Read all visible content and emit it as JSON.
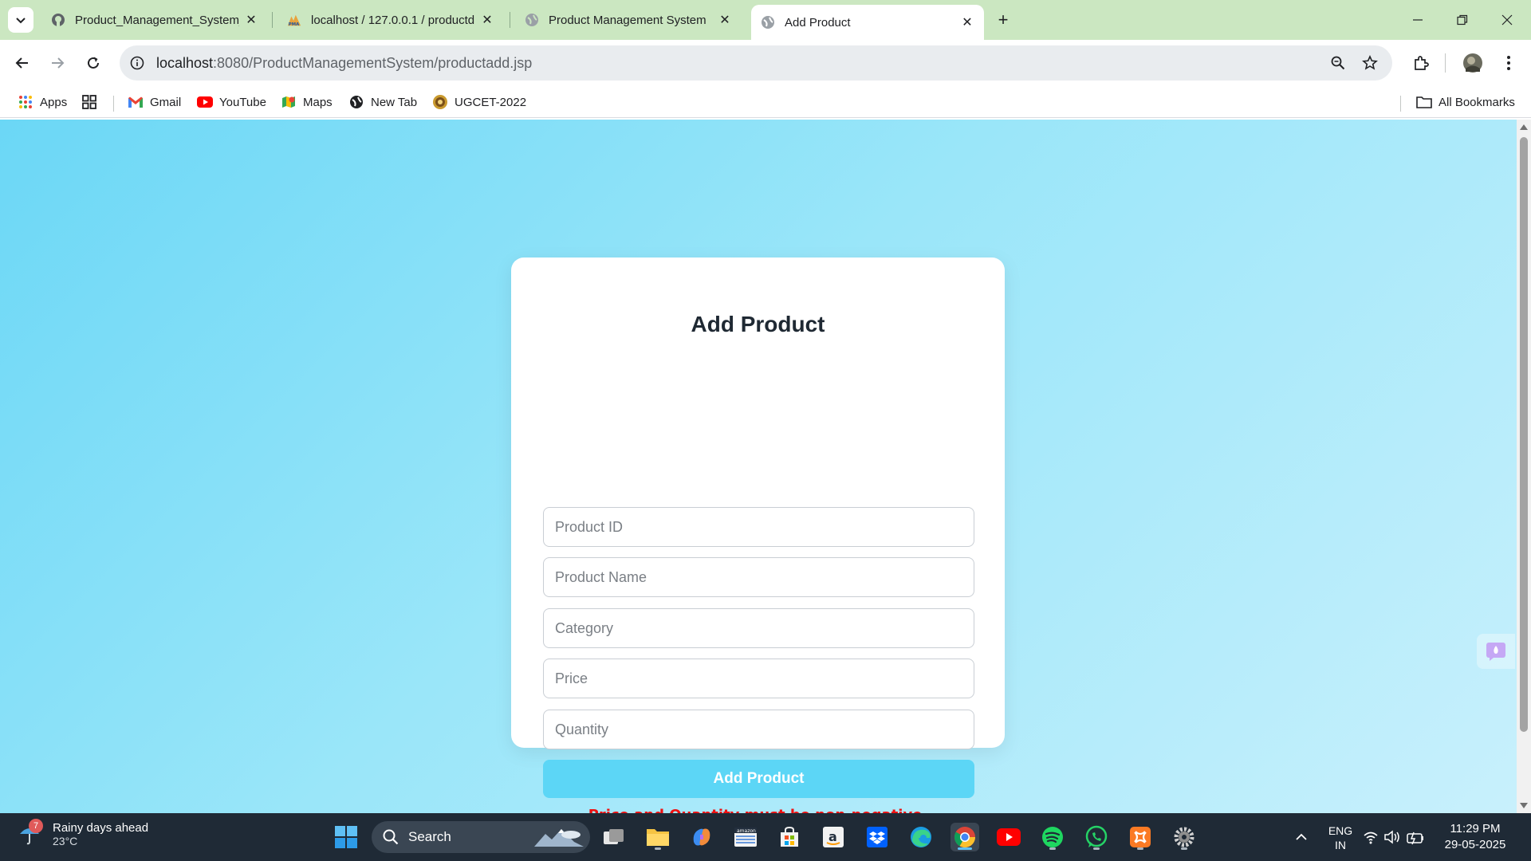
{
  "browser": {
    "tabs": [
      {
        "title": "Product_Management_System_",
        "favicon": "github-icon",
        "active": false
      },
      {
        "title": "localhost / 127.0.0.1 / productd",
        "favicon": "phpmyadmin-icon",
        "active": false
      },
      {
        "title": "Product Management System",
        "favicon": "globe-icon",
        "active": false
      },
      {
        "title": "Add Product",
        "favicon": "globe-icon",
        "active": true
      }
    ],
    "url_host": "localhost",
    "url_path": ":8080/ProductManagementSystem/productadd.jsp",
    "bookmarks": {
      "apps": "Apps",
      "gmail": "Gmail",
      "youtube": "YouTube",
      "maps": "Maps",
      "newtab": "New Tab",
      "ugcet": "UGCET-2022",
      "all": "All Bookmarks"
    }
  },
  "form": {
    "title": "Add Product",
    "fields": {
      "product_id": {
        "placeholder": "Product ID",
        "value": ""
      },
      "product_name": {
        "placeholder": "Product Name",
        "value": ""
      },
      "category": {
        "placeholder": "Category",
        "value": ""
      },
      "price": {
        "placeholder": "Price",
        "value": ""
      },
      "quantity": {
        "placeholder": "Quantity",
        "value": ""
      }
    },
    "submit_label": "Add Product",
    "error_message": "Price and Quantity must be non-negative."
  },
  "taskbar": {
    "weather_badge": "7",
    "weather_title": "Rainy days ahead",
    "weather_temp": "23°C",
    "search_label": "Search",
    "lang_line1": "ENG",
    "lang_line2": "IN",
    "time": "11:29 PM",
    "date": "29-05-2025"
  },
  "colors": {
    "page_gradient_start": "#6bd7f6",
    "page_gradient_end": "#c8f0fc",
    "button": "#5cd6f6",
    "error": "#ee1111",
    "tabstrip": "#cbe7c1"
  }
}
